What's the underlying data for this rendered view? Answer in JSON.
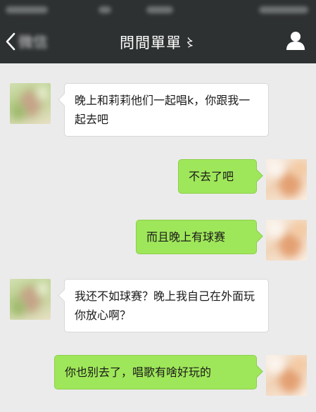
{
  "header": {
    "back_icon": "chevron-left-icon",
    "back_label": "微信",
    "title": "問間單單",
    "title_mark": "〻",
    "profile_icon": "person-icon"
  },
  "messages": [
    {
      "side": "left",
      "text": "晚上和莉莉他们一起唱k，你跟我一起去吧"
    },
    {
      "side": "right",
      "text": "不去了吧"
    },
    {
      "side": "right",
      "text": "而且晚上有球赛"
    },
    {
      "side": "left",
      "text": "我还不如球赛？晚上我自己在外面玩你放心啊？"
    },
    {
      "side": "right",
      "text": "你也别去了，唱歌有啥好玩的"
    }
  ],
  "colors": {
    "nav_background": "#2e3132",
    "chat_background": "#ebebeb",
    "outgoing_bubble": "#9fe75a",
    "incoming_bubble": "#ffffff"
  }
}
